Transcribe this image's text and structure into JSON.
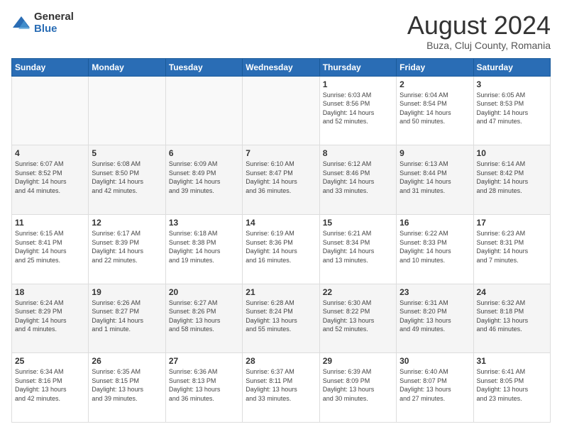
{
  "logo": {
    "general": "General",
    "blue": "Blue"
  },
  "header": {
    "title": "August 2024",
    "subtitle": "Buza, Cluj County, Romania"
  },
  "weekdays": [
    "Sunday",
    "Monday",
    "Tuesday",
    "Wednesday",
    "Thursday",
    "Friday",
    "Saturday"
  ],
  "weeks": [
    [
      {
        "day": "",
        "info": ""
      },
      {
        "day": "",
        "info": ""
      },
      {
        "day": "",
        "info": ""
      },
      {
        "day": "",
        "info": ""
      },
      {
        "day": "1",
        "info": "Sunrise: 6:03 AM\nSunset: 8:56 PM\nDaylight: 14 hours\nand 52 minutes."
      },
      {
        "day": "2",
        "info": "Sunrise: 6:04 AM\nSunset: 8:54 PM\nDaylight: 14 hours\nand 50 minutes."
      },
      {
        "day": "3",
        "info": "Sunrise: 6:05 AM\nSunset: 8:53 PM\nDaylight: 14 hours\nand 47 minutes."
      }
    ],
    [
      {
        "day": "4",
        "info": "Sunrise: 6:07 AM\nSunset: 8:52 PM\nDaylight: 14 hours\nand 44 minutes."
      },
      {
        "day": "5",
        "info": "Sunrise: 6:08 AM\nSunset: 8:50 PM\nDaylight: 14 hours\nand 42 minutes."
      },
      {
        "day": "6",
        "info": "Sunrise: 6:09 AM\nSunset: 8:49 PM\nDaylight: 14 hours\nand 39 minutes."
      },
      {
        "day": "7",
        "info": "Sunrise: 6:10 AM\nSunset: 8:47 PM\nDaylight: 14 hours\nand 36 minutes."
      },
      {
        "day": "8",
        "info": "Sunrise: 6:12 AM\nSunset: 8:46 PM\nDaylight: 14 hours\nand 33 minutes."
      },
      {
        "day": "9",
        "info": "Sunrise: 6:13 AM\nSunset: 8:44 PM\nDaylight: 14 hours\nand 31 minutes."
      },
      {
        "day": "10",
        "info": "Sunrise: 6:14 AM\nSunset: 8:42 PM\nDaylight: 14 hours\nand 28 minutes."
      }
    ],
    [
      {
        "day": "11",
        "info": "Sunrise: 6:15 AM\nSunset: 8:41 PM\nDaylight: 14 hours\nand 25 minutes."
      },
      {
        "day": "12",
        "info": "Sunrise: 6:17 AM\nSunset: 8:39 PM\nDaylight: 14 hours\nand 22 minutes."
      },
      {
        "day": "13",
        "info": "Sunrise: 6:18 AM\nSunset: 8:38 PM\nDaylight: 14 hours\nand 19 minutes."
      },
      {
        "day": "14",
        "info": "Sunrise: 6:19 AM\nSunset: 8:36 PM\nDaylight: 14 hours\nand 16 minutes."
      },
      {
        "day": "15",
        "info": "Sunrise: 6:21 AM\nSunset: 8:34 PM\nDaylight: 14 hours\nand 13 minutes."
      },
      {
        "day": "16",
        "info": "Sunrise: 6:22 AM\nSunset: 8:33 PM\nDaylight: 14 hours\nand 10 minutes."
      },
      {
        "day": "17",
        "info": "Sunrise: 6:23 AM\nSunset: 8:31 PM\nDaylight: 14 hours\nand 7 minutes."
      }
    ],
    [
      {
        "day": "18",
        "info": "Sunrise: 6:24 AM\nSunset: 8:29 PM\nDaylight: 14 hours\nand 4 minutes."
      },
      {
        "day": "19",
        "info": "Sunrise: 6:26 AM\nSunset: 8:27 PM\nDaylight: 14 hours\nand 1 minute."
      },
      {
        "day": "20",
        "info": "Sunrise: 6:27 AM\nSunset: 8:26 PM\nDaylight: 13 hours\nand 58 minutes."
      },
      {
        "day": "21",
        "info": "Sunrise: 6:28 AM\nSunset: 8:24 PM\nDaylight: 13 hours\nand 55 minutes."
      },
      {
        "day": "22",
        "info": "Sunrise: 6:30 AM\nSunset: 8:22 PM\nDaylight: 13 hours\nand 52 minutes."
      },
      {
        "day": "23",
        "info": "Sunrise: 6:31 AM\nSunset: 8:20 PM\nDaylight: 13 hours\nand 49 minutes."
      },
      {
        "day": "24",
        "info": "Sunrise: 6:32 AM\nSunset: 8:18 PM\nDaylight: 13 hours\nand 46 minutes."
      }
    ],
    [
      {
        "day": "25",
        "info": "Sunrise: 6:34 AM\nSunset: 8:16 PM\nDaylight: 13 hours\nand 42 minutes."
      },
      {
        "day": "26",
        "info": "Sunrise: 6:35 AM\nSunset: 8:15 PM\nDaylight: 13 hours\nand 39 minutes."
      },
      {
        "day": "27",
        "info": "Sunrise: 6:36 AM\nSunset: 8:13 PM\nDaylight: 13 hours\nand 36 minutes."
      },
      {
        "day": "28",
        "info": "Sunrise: 6:37 AM\nSunset: 8:11 PM\nDaylight: 13 hours\nand 33 minutes."
      },
      {
        "day": "29",
        "info": "Sunrise: 6:39 AM\nSunset: 8:09 PM\nDaylight: 13 hours\nand 30 minutes."
      },
      {
        "day": "30",
        "info": "Sunrise: 6:40 AM\nSunset: 8:07 PM\nDaylight: 13 hours\nand 27 minutes."
      },
      {
        "day": "31",
        "info": "Sunrise: 6:41 AM\nSunset: 8:05 PM\nDaylight: 13 hours\nand 23 minutes."
      }
    ]
  ]
}
